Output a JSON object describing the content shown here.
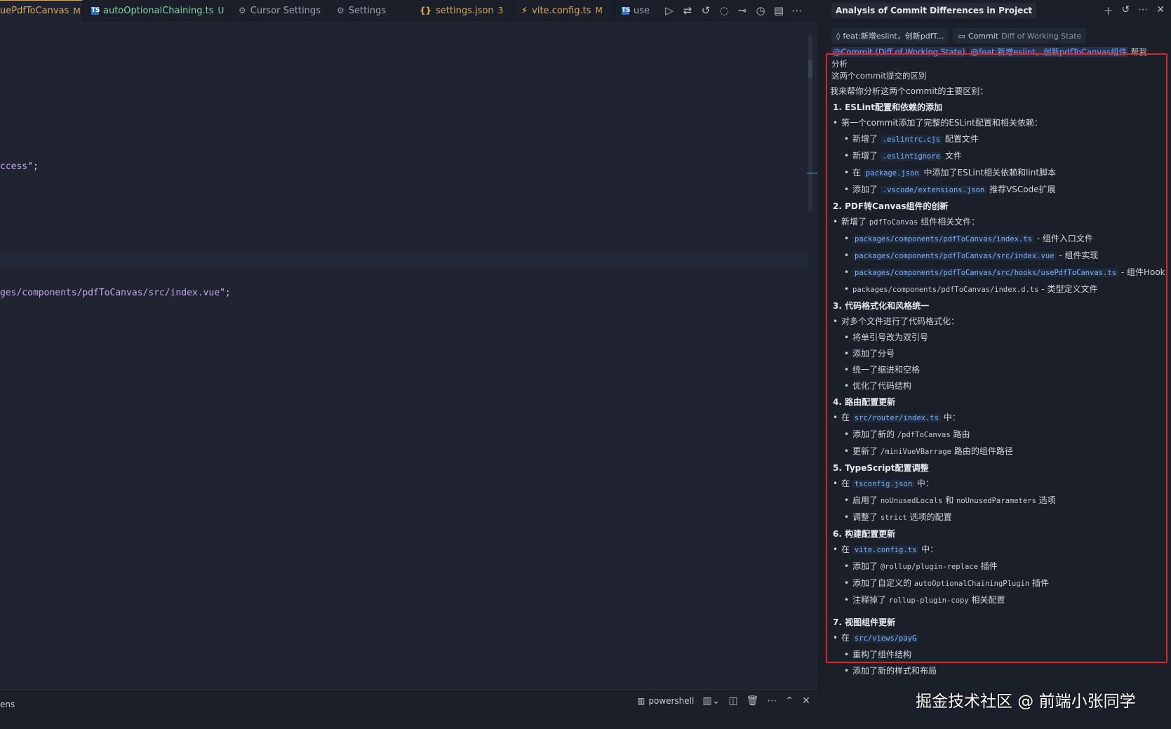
{
  "tabs": [
    {
      "label": "uePdfToCanvas",
      "status": "M",
      "active": true,
      "has_close": true
    },
    {
      "label": "autoOptionalChaining.ts",
      "status": "U",
      "icon": "ts-file-icon"
    },
    {
      "label": "Cursor Settings",
      "icon": "settings-icon"
    },
    {
      "label": "Settings",
      "icon": "settings-icon"
    },
    {
      "label": "settings.json",
      "status": "3",
      "icon": "json-braces-icon"
    },
    {
      "label": "vite.config.ts",
      "status": "M",
      "icon": "vite-bolt-icon"
    },
    {
      "label": "use",
      "icon": "ts-file-icon"
    }
  ],
  "tab_actions": [
    "run-icon",
    "compare-changes-icon",
    "git-history-icon",
    "git-prev-icon",
    "git-next-icon",
    "timeline-icon",
    "split-editor-icon",
    "more-icon"
  ],
  "editor": {
    "line1": {
      "text": "ccess",
      "tail": "\";"
    },
    "line2": {
      "text": "ges/components/pdfToCanvas/src/index.vue",
      "tail": "\";"
    }
  },
  "panel": {
    "label": "ens",
    "terminal_name": "powershell"
  },
  "chat": {
    "title": "Analysis of Commit Differences in Project",
    "context_chips": [
      {
        "icon": "commit-icon",
        "label": "feat:新增eslint，创新pdfT..."
      },
      {
        "icon": "commit-icon",
        "label": "Commit",
        "sub": "Diff of Working State"
      }
    ],
    "query": {
      "mention1": "@Commit (Diff of Working State)",
      "mention2": "@feat:新增eslint，创新pdfToCanvas组件",
      "text_a": "帮我分析",
      "text_b": "这两个commit提交的区别"
    },
    "answer": {
      "intro": "我来帮你分析这两个commit的主要区别：",
      "s1": {
        "title": "1. ESLint配置和依赖的添加",
        "b1": "第一个commit添加了完整的ESLint配置和相关依赖：",
        "i1a": "新增了",
        "i1c": ".eslintrc.cjs",
        "i1b": "配置文件",
        "i2a": "新增了",
        "i2c": ".eslintignore",
        "i2b": "文件",
        "i3a": "在",
        "i3c": "package.json",
        "i3b": "中添加了ESLint相关依赖和lint脚本",
        "i4a": "添加了",
        "i4c": ".vscode/extensions.json",
        "i4b": "推荐VSCode扩展"
      },
      "s2": {
        "title": "2. PDF转Canvas组件的创新",
        "b1a": "新增了",
        "b1c": "pdfToCanvas",
        "b1b": "组件相关文件：",
        "i1c": "packages/components/pdfToCanvas/index.ts",
        "i1b": "- 组件入口文件",
        "i2c": "packages/components/pdfToCanvas/src/index.vue",
        "i2b": "- 组件实现",
        "i3c": "packages/components/pdfToCanvas/src/hooks/usePdfToCanvas.ts",
        "i3b": "- 组件Hook",
        "i4c": "packages/components/pdfToCanvas/index.d.ts",
        "i4b": "- 类型定义文件"
      },
      "s3": {
        "title": "3. 代码格式化和风格统一",
        "b1": "对多个文件进行了代码格式化：",
        "i1": "将单引号改为双引号",
        "i2": "添加了分号",
        "i3": "统一了缩进和空格",
        "i4": "优化了代码结构"
      },
      "s4": {
        "title": "4. 路由配置更新",
        "b1a": "在",
        "b1c": "src/router/index.ts",
        "b1b": "中：",
        "i1a": "添加了新的",
        "i1c": "/pdfToCanvas",
        "i1b": "路由",
        "i2a": "更新了",
        "i2c": "/miniVueVBarrage",
        "i2b": "路由的组件路径"
      },
      "s5": {
        "title": "5. TypeScript配置调整",
        "b1a": "在",
        "b1c": "tsconfig.json",
        "b1b": "中：",
        "i1a": "启用了",
        "i1c": "noUnusedLocals",
        "i1m": "和",
        "i1d": "noUnusedParameters",
        "i1b": "选项",
        "i2a": "调整了",
        "i2c": "strict",
        "i2b": "选项的配置"
      },
      "s6": {
        "title": "6. 构建配置更新",
        "b1a": "在",
        "b1c": "vite.config.ts",
        "b1b": "中：",
        "i1a": "添加了",
        "i1c": "@rollup/plugin-replace",
        "i1b": "插件",
        "i2a": "添加了自定义的",
        "i2c": "autoOptionalChainingPlugin",
        "i2b": "插件",
        "i3a": "注释掉了",
        "i3c": "rollup-plugin-copy",
        "i3b": "相关配置"
      },
      "s7": {
        "title": "7. 视图组件更新",
        "b1a": "在",
        "b1c": "src/views/payG",
        "i1": "重构了组件结构",
        "i2": "添加了新的样式和布局"
      }
    },
    "highlight_color": "#e02424"
  },
  "watermark": "掘金技术社区 @ 前端小张同学"
}
